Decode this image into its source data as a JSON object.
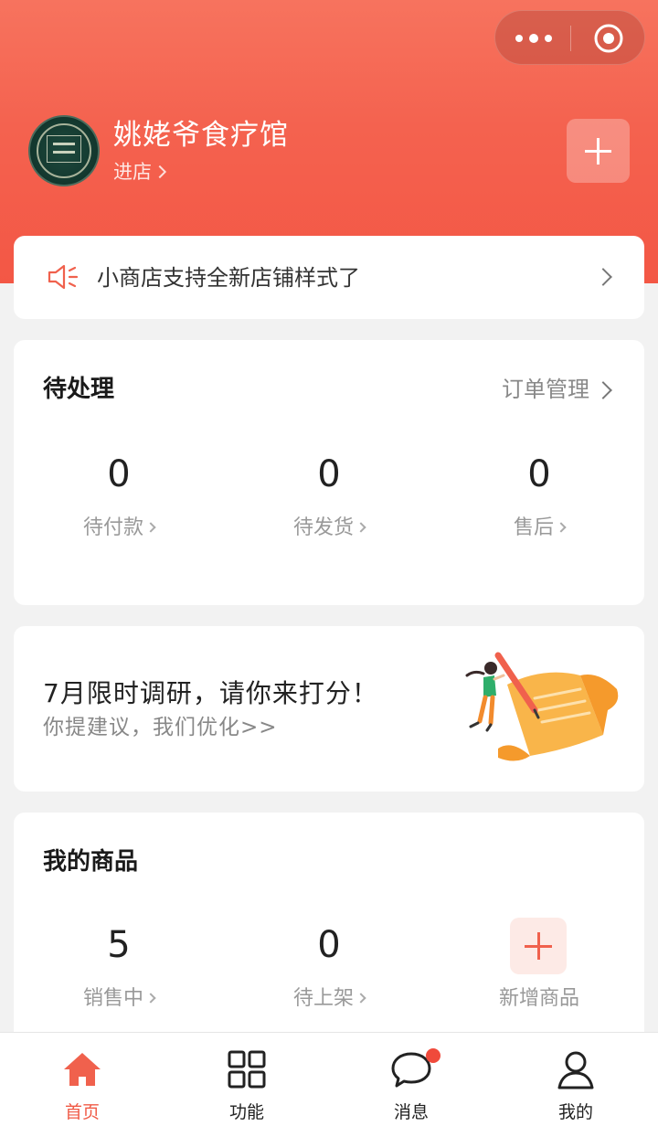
{
  "header": {
    "shop_name": "姚姥爷食疗馆",
    "enter_label": "进店"
  },
  "notice": {
    "text": "小商店支持全新店铺样式了"
  },
  "pending": {
    "title": "待处理",
    "link": "订单管理",
    "stats": [
      {
        "value": "0",
        "label": "待付款"
      },
      {
        "value": "0",
        "label": "待发货"
      },
      {
        "value": "0",
        "label": "售后"
      }
    ]
  },
  "survey": {
    "title": "7月限时调研，请你来打分！",
    "subtitle": "你提建议，我们优化>>"
  },
  "goods": {
    "title": "我的商品",
    "stats": [
      {
        "value": "5",
        "label": "销售中"
      },
      {
        "value": "0",
        "label": "待上架"
      }
    ],
    "add_label": "新增商品"
  },
  "tabbar": {
    "items": [
      {
        "label": "首页",
        "icon": "home-icon",
        "active": true
      },
      {
        "label": "功能",
        "icon": "grid-icon"
      },
      {
        "label": "消息",
        "icon": "message-icon"
      },
      {
        "label": "我的",
        "icon": "person-icon"
      }
    ]
  },
  "colors": {
    "accent": "#f35745",
    "accent_light": "#fdeae6",
    "badge": "#f04a3b"
  }
}
